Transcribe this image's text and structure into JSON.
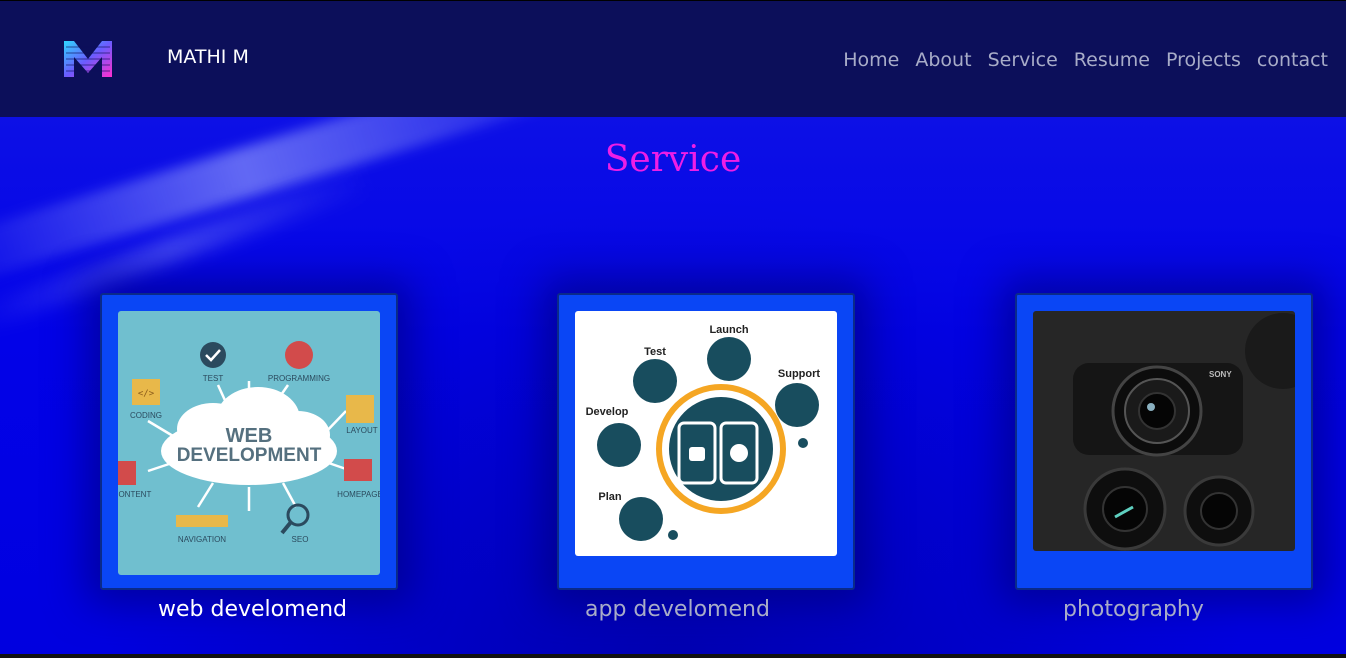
{
  "header": {
    "brand": "MATHI M",
    "logo_letter": "M",
    "nav": [
      "Home",
      "About",
      "Service",
      "Resume",
      "Projects",
      "contact"
    ]
  },
  "main": {
    "title": "Service",
    "cards": [
      {
        "label": "web develomend",
        "image_text": {
          "headline1": "WEB",
          "headline2": "DEVELOPMENT",
          "tags": [
            "TEST",
            "PROGRAMMING",
            "CODING",
            "LAYOUT",
            "CONTENT",
            "HOMEPAGE",
            "NAVIGATION",
            "SEO"
          ]
        }
      },
      {
        "label": "app develomend",
        "image_text": {
          "steps": [
            "Launch",
            "Test",
            "Support",
            "Develop",
            "Plan"
          ]
        }
      },
      {
        "label": "photography",
        "image_text": {
          "brand": "SONY"
        }
      }
    ]
  },
  "colors": {
    "navbar": "#0c0f5a",
    "background": "#0000e6",
    "card": "#0a46f5",
    "title": "#ee1ee6",
    "nav_text": "#a8acc8"
  }
}
